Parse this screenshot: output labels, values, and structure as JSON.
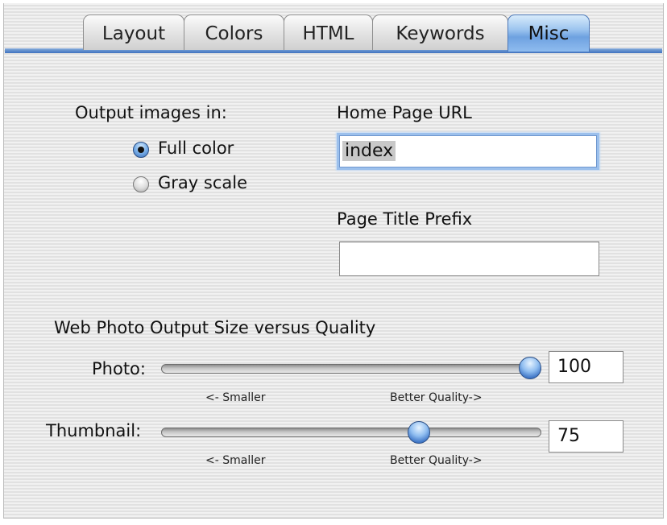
{
  "tabs": [
    {
      "label": "Layout",
      "active": false
    },
    {
      "label": "Colors",
      "active": false
    },
    {
      "label": "HTML",
      "active": false
    },
    {
      "label": "Keywords",
      "active": false
    },
    {
      "label": "Misc",
      "active": true
    }
  ],
  "output_images": {
    "label": "Output images in:",
    "options": [
      {
        "label": "Full color",
        "selected": true
      },
      {
        "label": "Gray scale",
        "selected": false
      }
    ]
  },
  "home_page_url": {
    "label": "Home Page URL",
    "value": "index"
  },
  "page_title_prefix": {
    "label": "Page Title Prefix",
    "value": ""
  },
  "quality": {
    "heading": "Web Photo Output Size versus Quality",
    "photo": {
      "label": "Photo:",
      "value": "100",
      "level_percent": 100,
      "min_hint": "<- Smaller",
      "max_hint": "Better Quality->"
    },
    "thumbnail": {
      "label": "Thumbnail:",
      "value": "75",
      "level_percent": 69,
      "min_hint": "<- Smaller",
      "max_hint": "Better Quality->"
    }
  },
  "colors": {
    "accent": "#5b8fd6",
    "panel": "#ececec"
  }
}
